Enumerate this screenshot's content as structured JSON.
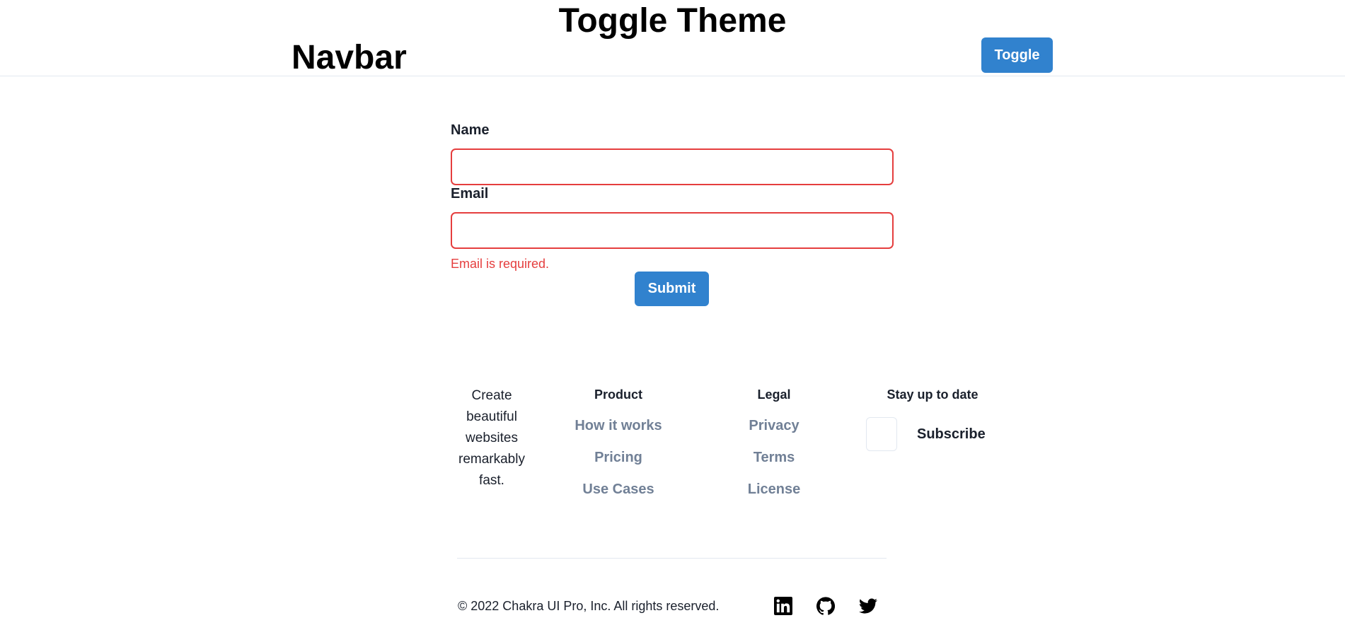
{
  "header": {
    "title": "Toggle Theme",
    "brand": "Navbar",
    "toggle_label": "Toggle"
  },
  "form": {
    "name_label": "Name",
    "name_value": "",
    "email_label": "Email",
    "email_value": "",
    "email_error": "Email is required.",
    "submit_label": "Submit",
    "error_color": "#e53e3e",
    "accent_color": "#3182ce"
  },
  "footer": {
    "tagline": "Create beautiful websites remarkably fast.",
    "columns": [
      {
        "title": "Product",
        "links": [
          "How it works",
          "Pricing",
          "Use Cases"
        ]
      },
      {
        "title": "Legal",
        "links": [
          "Privacy",
          "Terms",
          "License"
        ]
      }
    ],
    "newsletter": {
      "title": "Stay up to date",
      "input_value": "",
      "subscribe_label": "Subscribe"
    },
    "copyright": "© 2022 Chakra UI Pro, Inc. All rights reserved.",
    "social_icons": [
      "linkedin-icon",
      "github-icon",
      "twitter-icon"
    ]
  }
}
